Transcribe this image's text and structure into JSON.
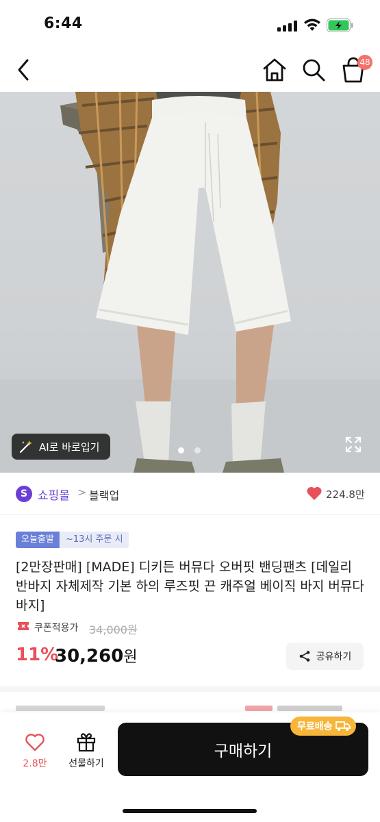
{
  "status_bar": {
    "time": "6:44",
    "battery_color": "#32c759"
  },
  "nav": {
    "back_icon": "chevron-left-icon",
    "home_icon": "home-icon",
    "search_icon": "search-icon",
    "cart_icon": "shopping-bag-icon",
    "cart_badge": "48"
  },
  "product_image": {
    "ai_button_label": "AI로 바로입기",
    "image_count": 2,
    "active_image": 1
  },
  "shop": {
    "logo_letter": "S",
    "name": "쇼핑몰",
    "separator": ">",
    "brand": "블랙업",
    "likes": "224.8만",
    "accent_color": "#6a3fd6"
  },
  "badges": {
    "delivery": "오늘출발",
    "cutoff": "~13시 주문 시"
  },
  "product": {
    "title": "[2만장판매] [MADE] 디키든 버뮤다 오버핏 밴딩팬츠 [데일리 반바지 자체제작 기본 하의 루즈핏 끈 캐주얼 베이직 바지 버뮤다바지]",
    "coupon_label": "쿠폰적용가",
    "original_price": "34,000원",
    "discount": "11%",
    "price": "30,260",
    "price_unit": "원",
    "share_label": "공유하기"
  },
  "bottom_bar": {
    "heart_count": "2.8만",
    "gift_label": "선물하기",
    "buy_label": "구매하기",
    "free_shipping": "무료배송"
  }
}
